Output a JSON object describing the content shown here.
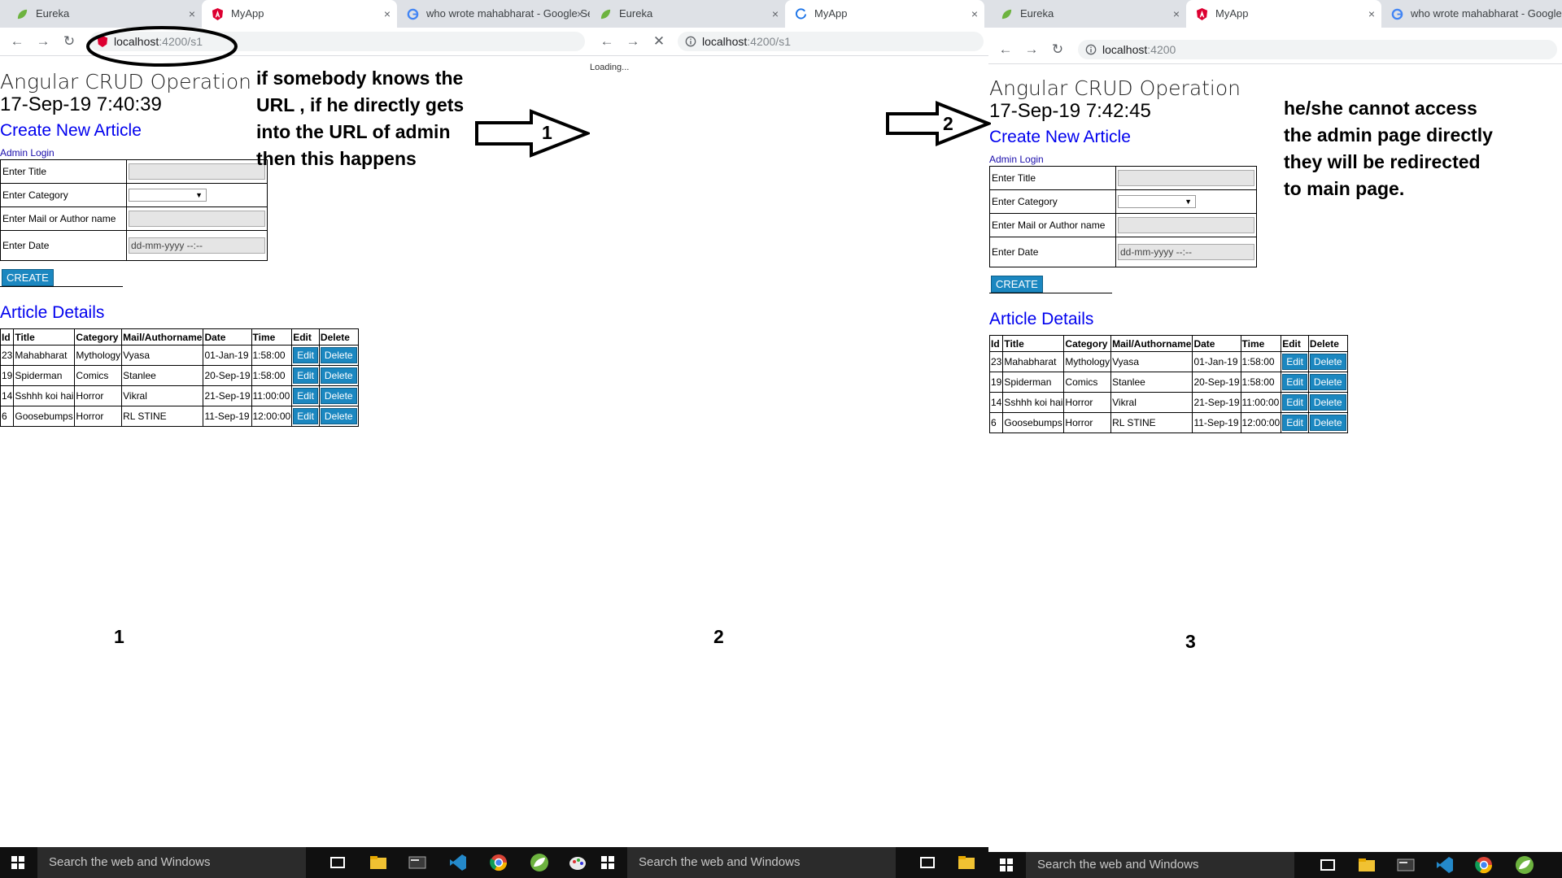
{
  "tabs": {
    "eureka": "Eureka",
    "myapp": "MyApp",
    "google": "who wrote mahabharat - Google Search",
    "close": "×"
  },
  "urls": {
    "admin_host": "localhost",
    "admin_path": ":4200/s1",
    "home_host": "localhost",
    "home_path": ":4200"
  },
  "app": {
    "title": "Angular CRUD Operation",
    "date_panel1": "17-Sep-19 7:40:39",
    "date_panel3": "17-Sep-19 7:42:45",
    "create_heading": "Create New Article",
    "admin_login": "Admin Login",
    "form": {
      "title_label": "Enter Title",
      "category_label": "Enter Category",
      "author_label": "Enter Mail or Author name",
      "date_label": "Enter Date",
      "date_placeholder": "dd-mm-yyyy --:--",
      "select_arrow": "▼",
      "create_button": "CREATE"
    },
    "details_heading": "Article Details",
    "table": {
      "headers": [
        "Id",
        "Title",
        "Category",
        "Mail/Authorname",
        "Date",
        "Time",
        "Edit",
        "Delete"
      ],
      "edit_label": "Edit",
      "delete_label": "Delete",
      "rows": [
        [
          "23",
          "Mahabharat",
          "Mythology",
          "Vyasa",
          "01-Jan-19",
          "1:58:00"
        ],
        [
          "19",
          "Spiderman",
          "Comics",
          "Stanlee",
          "20-Sep-19",
          "1:58:00"
        ],
        [
          "14",
          "Sshhh koi hai",
          "Horror",
          "Vikral",
          "21-Sep-19",
          "11:00:00"
        ],
        [
          "6",
          "Goosebumps",
          "Horror",
          "RL STINE",
          "11-Sep-19",
          "12:00:00"
        ]
      ]
    }
  },
  "loading_text": "Loading...",
  "annotations": {
    "panel1": [
      "if somebody knows the",
      "URL , if he directly gets",
      "into the URL of admin",
      "then this happens"
    ],
    "panel3": [
      "he/she cannot access",
      "the admin page directly",
      "they will be redirected",
      "to main page."
    ],
    "arrow1": "1",
    "arrow2": "2",
    "num1": "1",
    "num2": "2",
    "num3": "3"
  },
  "taskbar": {
    "search_placeholder": "Search the web and Windows"
  },
  "colors": {
    "link_blue": "#0000ee",
    "button_blue": "#1b87c0",
    "tab_strip": "#dee1e6",
    "taskbar": "#101010"
  }
}
